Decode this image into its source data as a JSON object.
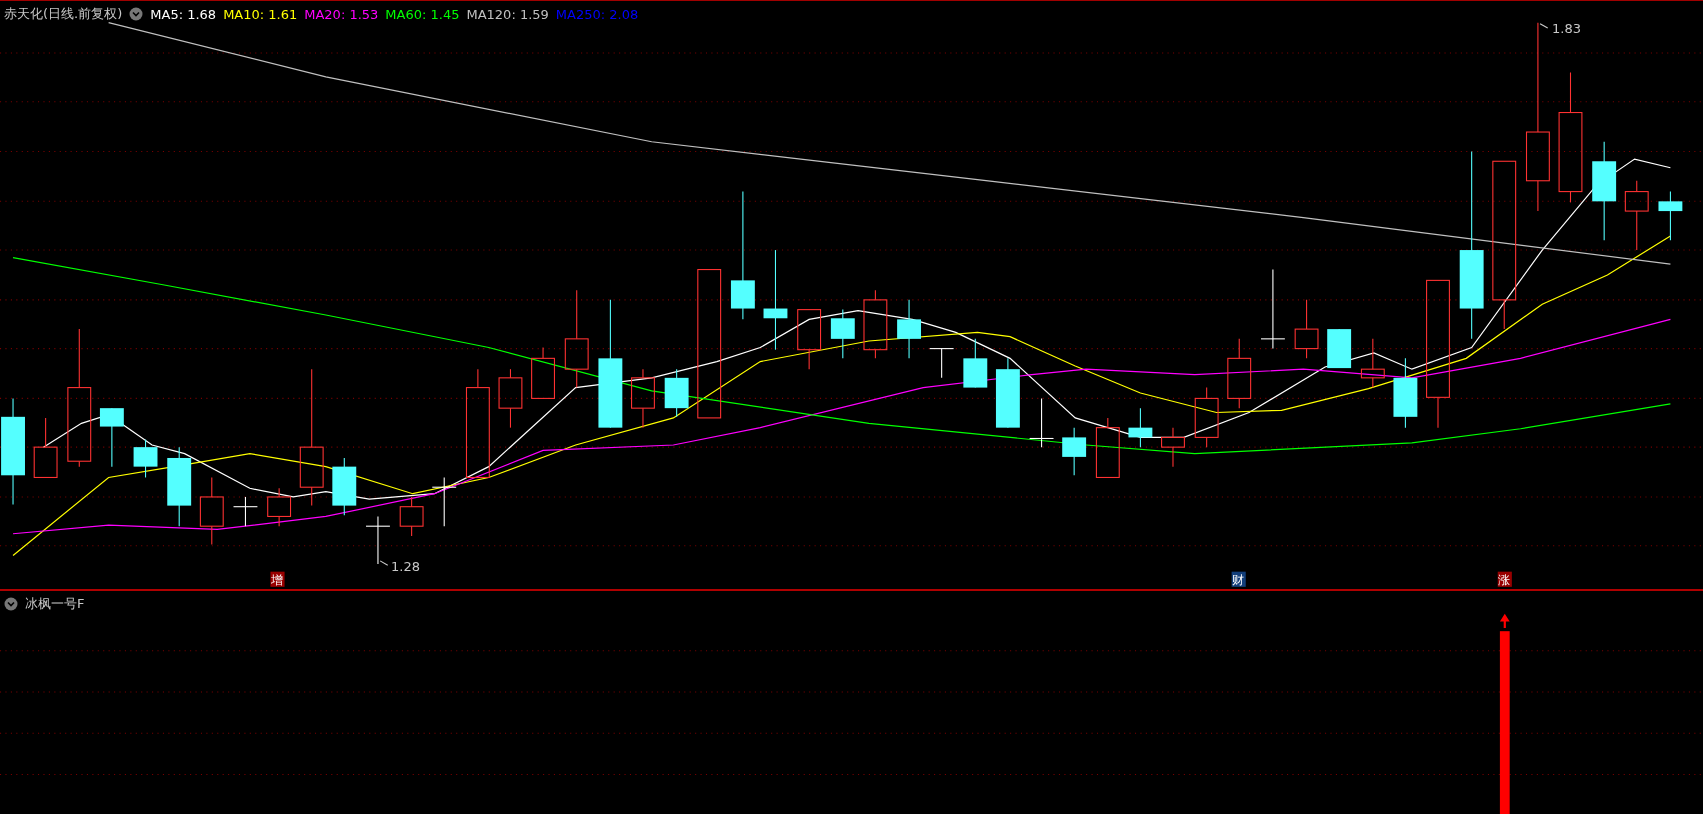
{
  "main_chart": {
    "title": "赤天化(日线.前复权)",
    "legend": [
      {
        "label": "MA5: 1.68",
        "color": "#ffffff"
      },
      {
        "label": "MA10: 1.61",
        "color": "#ffff00"
      },
      {
        "label": "MA20: 1.53",
        "color": "#ff00ff"
      },
      {
        "label": "MA60: 1.45",
        "color": "#00ff00"
      },
      {
        "label": "MA120: 1.59",
        "color": "#c0c0c0"
      },
      {
        "label": "MA250: 2.08",
        "color": "#0000ff"
      }
    ],
    "high_marker": "1.83",
    "low_marker": "1.28",
    "signals": [
      {
        "label": "增",
        "color": "#990000"
      },
      {
        "label": "财",
        "color": "#123e7a"
      },
      {
        "label": "涨",
        "color": "#990000"
      }
    ]
  },
  "indicator_panel": {
    "title": "冰枫一号F"
  }
}
